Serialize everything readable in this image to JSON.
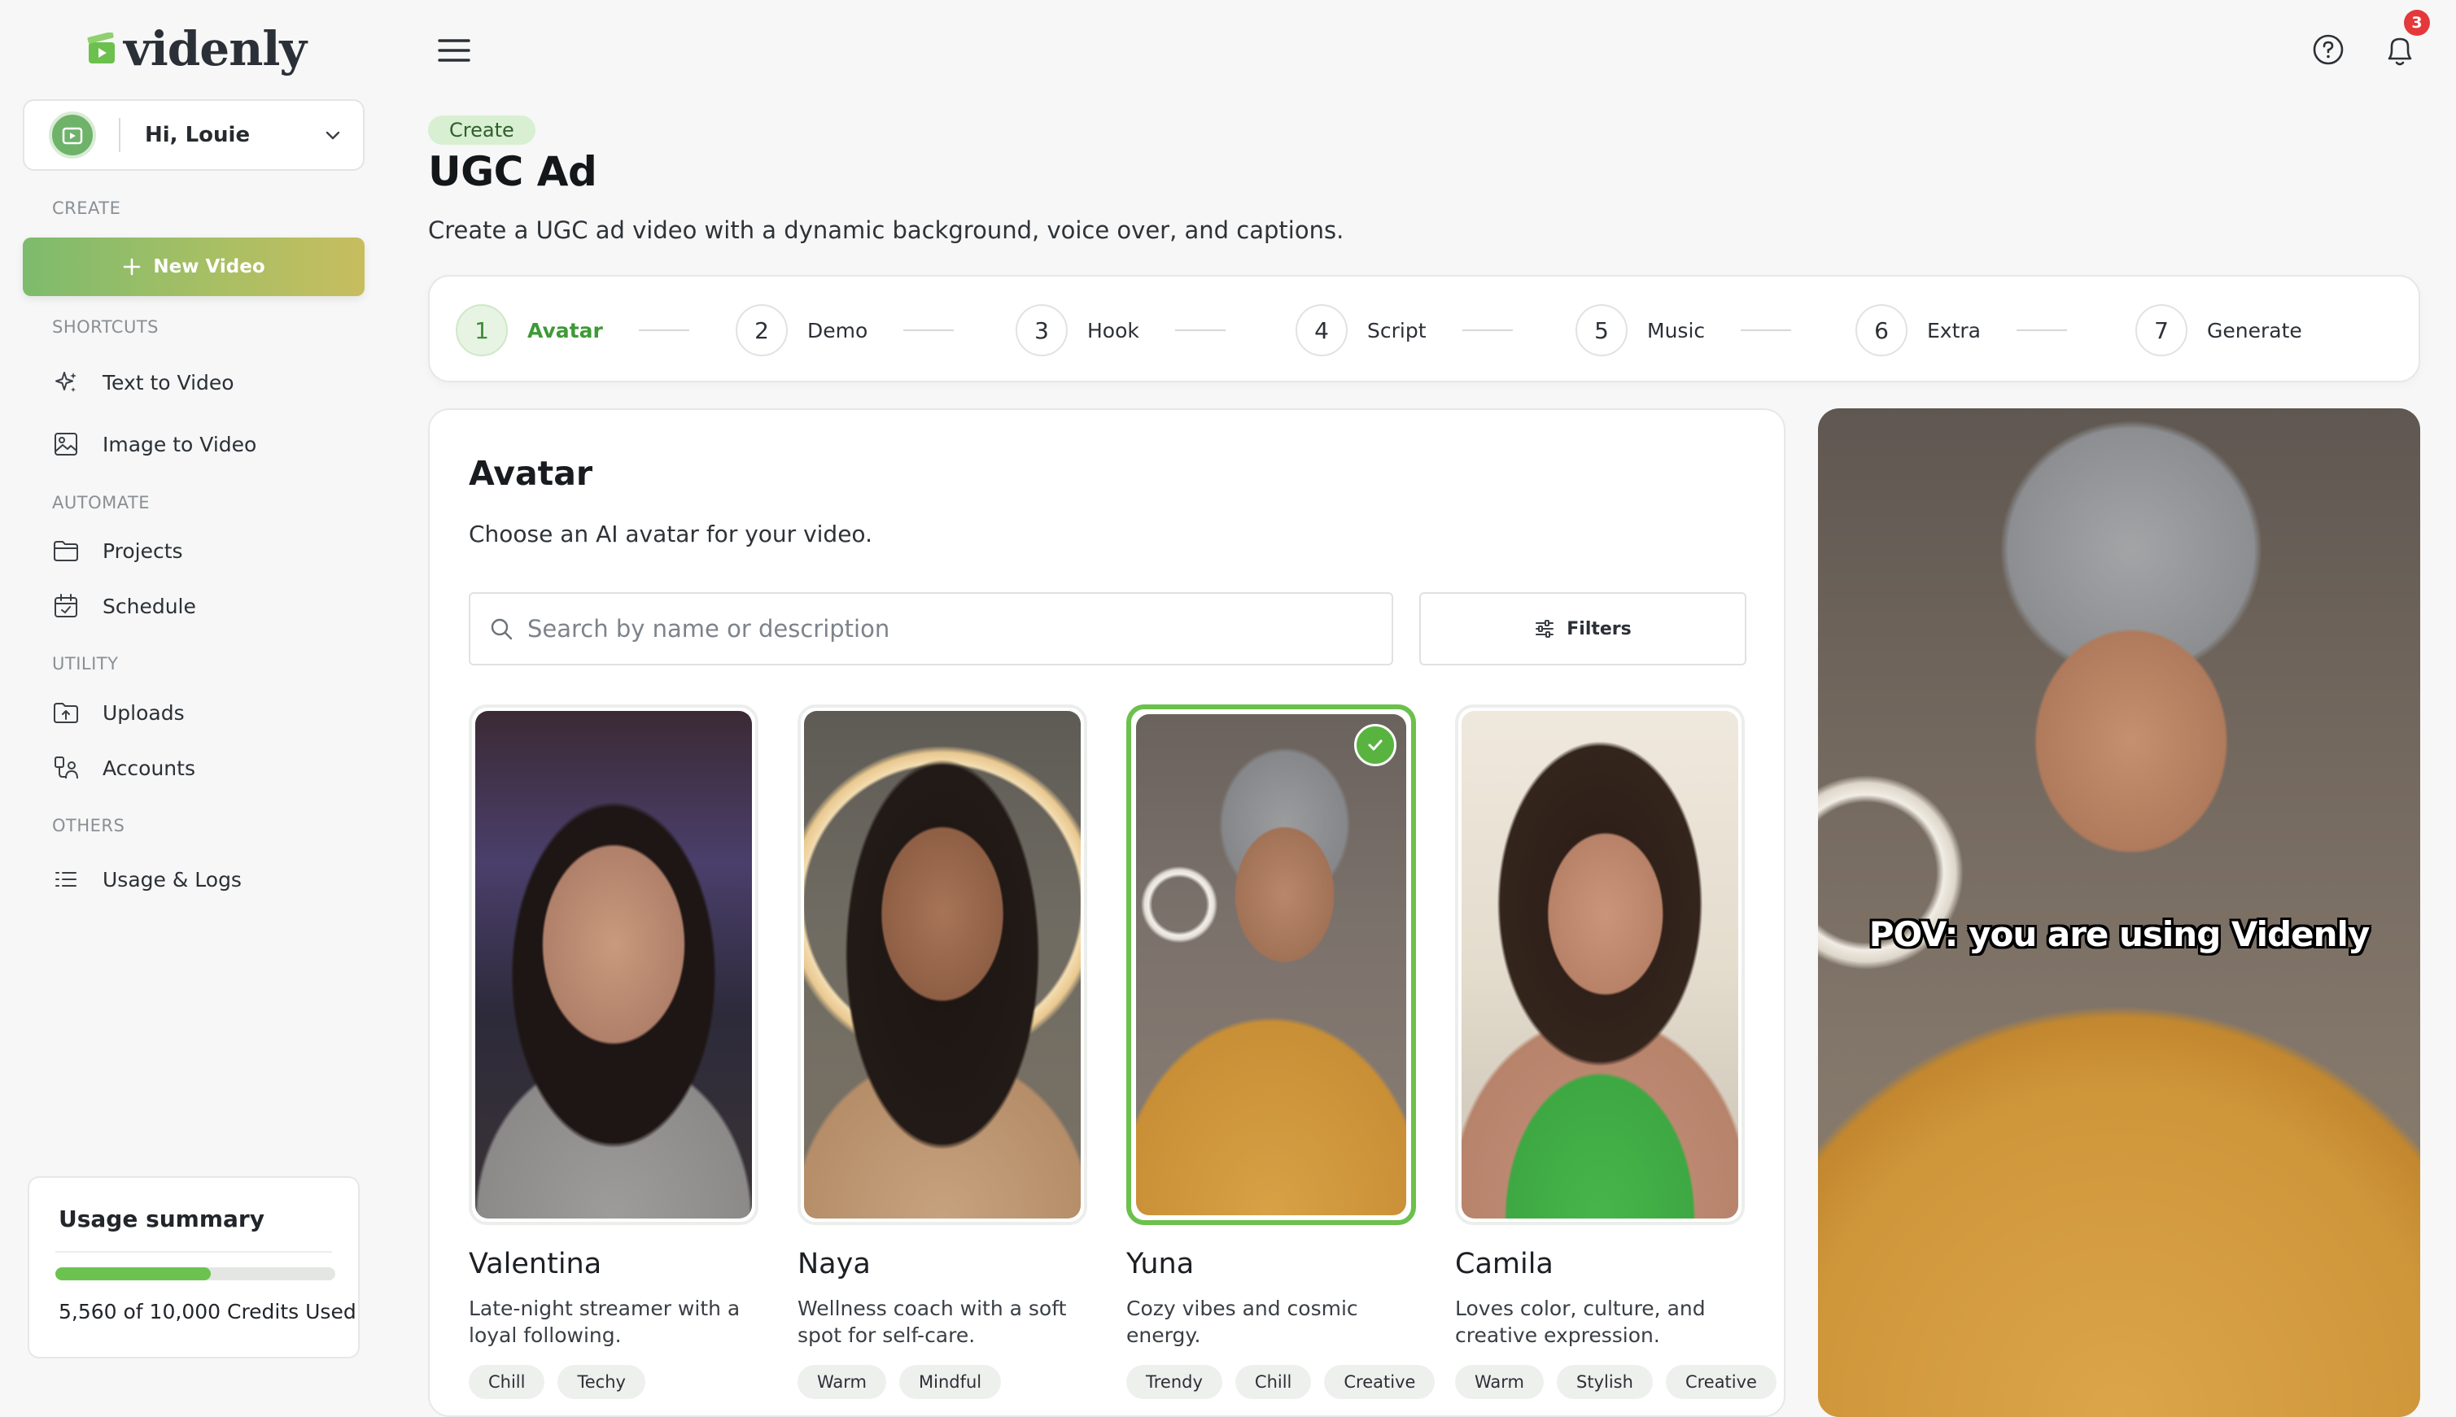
{
  "brand": {
    "name": "videnly",
    "accent": "#6cc04d"
  },
  "user": {
    "greeting": "Hi, Louie"
  },
  "sidebar": {
    "sections": {
      "create": "CREATE",
      "shortcuts": "SHORTCUTS",
      "automate": "AUTOMATE",
      "utility": "UTILITY",
      "others": "OTHERS"
    },
    "new_video": "New Video",
    "items": {
      "text_to_video": "Text to Video",
      "image_to_video": "Image to Video",
      "projects": "Projects",
      "schedule": "Schedule",
      "uploads": "Uploads",
      "accounts": "Accounts",
      "usage_logs": "Usage & Logs"
    },
    "usage": {
      "title": "Usage summary",
      "text": "5,560 of 10,000 Credits Used",
      "fraction": 0.556
    }
  },
  "topbar": {
    "notifications": "3"
  },
  "header": {
    "breadcrumb": "Create",
    "title": "UGC Ad",
    "subtitle": "Create a UGC ad video with a dynamic background, voice over, and captions."
  },
  "steps": [
    {
      "num": "1",
      "label": "Avatar",
      "active": true
    },
    {
      "num": "2",
      "label": "Demo"
    },
    {
      "num": "3",
      "label": "Hook"
    },
    {
      "num": "4",
      "label": "Script"
    },
    {
      "num": "5",
      "label": "Music"
    },
    {
      "num": "6",
      "label": "Extra"
    },
    {
      "num": "7",
      "label": "Generate"
    }
  ],
  "avatar_panel": {
    "title": "Avatar",
    "subtitle": "Choose an AI avatar for your video.",
    "search_placeholder": "Search by name or description",
    "filters_label": "Filters",
    "avatars": [
      {
        "name": "Valentina",
        "desc": "Late-night streamer with a loyal following.",
        "tags": [
          "Chill",
          "Techy"
        ]
      },
      {
        "name": "Naya",
        "desc": "Wellness coach with a soft spot for self-care.",
        "tags": [
          "Warm",
          "Mindful"
        ]
      },
      {
        "name": "Yuna",
        "desc": "Cozy vibes and cosmic energy.",
        "tags": [
          "Trendy",
          "Chill",
          "Creative"
        ],
        "selected": true
      },
      {
        "name": "Camila",
        "desc": "Loves color, culture, and creative expression.",
        "tags": [
          "Warm",
          "Stylish",
          "Creative"
        ]
      }
    ]
  },
  "preview": {
    "caption": "POV: you are using Videnly"
  }
}
